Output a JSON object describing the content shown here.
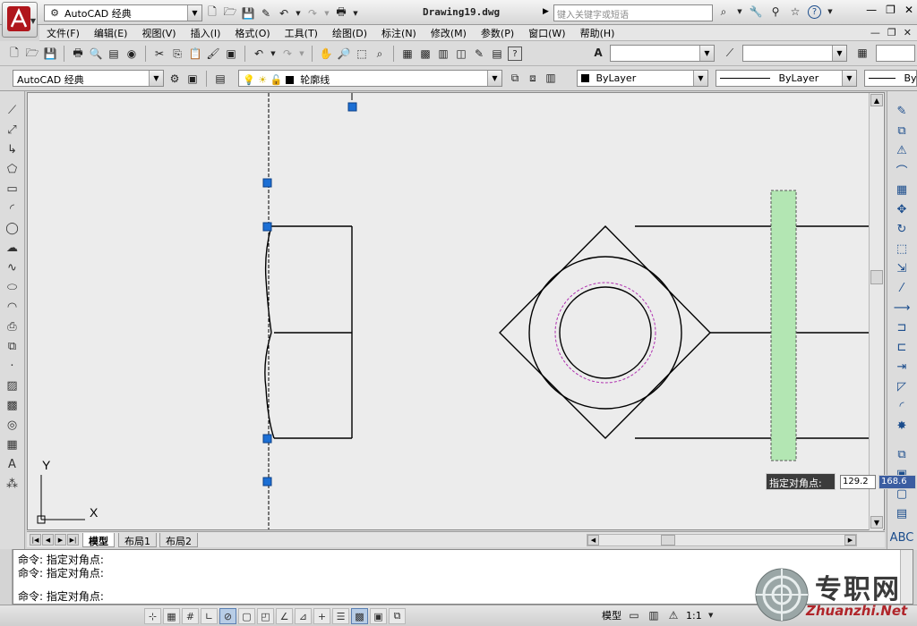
{
  "titlebar": {
    "workspace": "AutoCAD 经典",
    "document": "Drawing19.dwg",
    "search_placeholder": "键入关键字或短语"
  },
  "menu": [
    "文件(F)",
    "编辑(E)",
    "视图(V)",
    "插入(I)",
    "格式(O)",
    "工具(T)",
    "绘图(D)",
    "标注(N)",
    "修改(M)",
    "参数(P)",
    "窗口(W)",
    "帮助(H)"
  ],
  "toolbar": {
    "workspace_combo": "AutoCAD 经典",
    "layer": "轮廓线",
    "color": "ByLayer",
    "linetype": "ByLayer",
    "lineweight": "By"
  },
  "dynamic_input": {
    "prompt": "指定对角点:",
    "value1": "129.2",
    "value2": "168.6"
  },
  "tabs": [
    "模型",
    "布局1",
    "布局2"
  ],
  "command_lines": [
    "命令: 指定对角点:",
    "命令: 指定对角点:",
    "命令: 指定对角点:"
  ],
  "status": {
    "model_label": "模型",
    "scale": "1:1"
  },
  "watermark": {
    "cn": "专职网",
    "en": "Zhuanzhi.Net"
  },
  "ucs": {
    "x_label": "X",
    "y_label": "Y"
  },
  "colors": {
    "grip": "#1c6fd4",
    "selection_fill": "#b3e6b3",
    "hidden_circle": "#b030b0",
    "canvas": "#ececec"
  }
}
